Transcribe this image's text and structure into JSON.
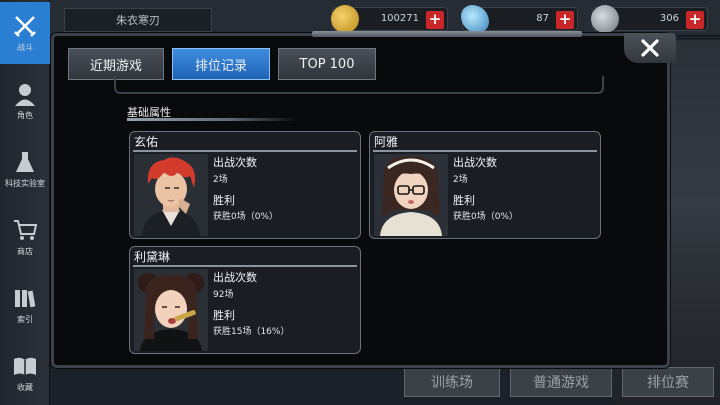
{
  "sidebar": {
    "items": [
      {
        "label": "战斗",
        "icon": "crossed-swords-icon"
      },
      {
        "label": "角色",
        "icon": "character-icon"
      },
      {
        "label": "科技实验室",
        "icon": "flask-icon"
      },
      {
        "label": "商店",
        "icon": "cart-icon"
      },
      {
        "label": "索引",
        "icon": "books-icon"
      },
      {
        "label": "收藏",
        "icon": "open-book-icon"
      }
    ]
  },
  "topbar": {
    "tab_label": "朱衣寒刃",
    "resources": [
      {
        "value": "100271",
        "icon": "gold-coin-icon"
      },
      {
        "value": "87",
        "icon": "crystal-icon"
      },
      {
        "value": "306",
        "icon": "bp-badge-icon"
      }
    ]
  },
  "background_buttons": [
    "训练场",
    "普通游戏",
    "排位赛"
  ],
  "dialog": {
    "tabs": [
      {
        "label": "近期游戏",
        "active": false
      },
      {
        "label": "排位记录",
        "active": true
      },
      {
        "label": "TOP 100",
        "active": false
      }
    ],
    "section_title": "基础属性",
    "characters": [
      {
        "name": "玄佑",
        "battles_label": "出战次数",
        "battles_value": "2场",
        "wins_label": "胜利",
        "wins_value": "获胜0场（0%）",
        "portrait": "red-haired-man-portrait"
      },
      {
        "name": "阿雅",
        "battles_label": "出战次数",
        "battles_value": "2场",
        "wins_label": "胜利",
        "wins_value": "获胜0场（0%）",
        "portrait": "dark-haired-woman-glasses-portrait"
      },
      {
        "name": "利黛琳",
        "battles_label": "出战次数",
        "battles_value": "92场",
        "wins_label": "胜利",
        "wins_value": "获胜15场（16%）",
        "portrait": "dark-haired-woman-buns-portrait"
      }
    ]
  },
  "colors": {
    "accent": "#2b7fd3",
    "plus_button": "#c9262a",
    "dialog_bg": "#090a0c"
  }
}
